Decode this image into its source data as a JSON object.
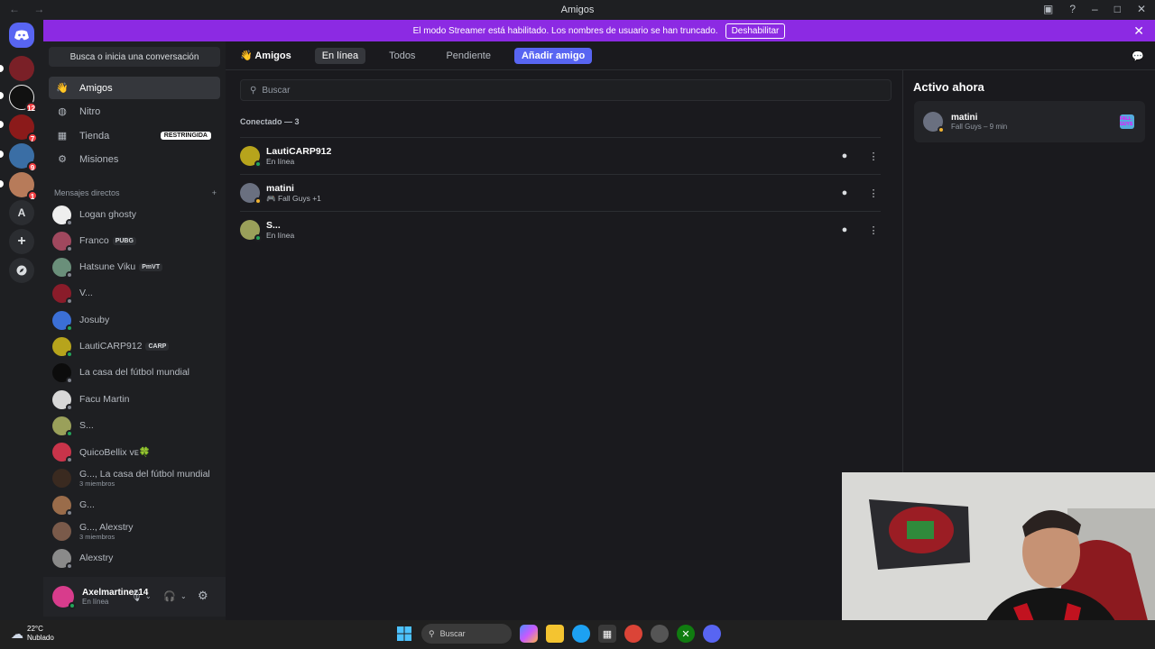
{
  "window": {
    "title": "Amigos",
    "nav_arrows": "← →"
  },
  "banner": {
    "text": "El modo Streamer está habilitado. Los nombres de usuario se han truncado.",
    "button": "Deshabilitar"
  },
  "servers": [
    {
      "label": "",
      "badge": ""
    },
    {
      "label": "",
      "badge": "12"
    },
    {
      "label": "",
      "badge": "7"
    },
    {
      "label": "",
      "badge": "9"
    },
    {
      "label": "",
      "badge": "1"
    },
    {
      "label": "A",
      "badge": ""
    }
  ],
  "sidebar": {
    "search": "Busca o inicia una conversación",
    "menu": [
      {
        "label": "Amigos"
      },
      {
        "label": "Nitro"
      },
      {
        "label": "Tienda",
        "tag": "RESTRINGIDA"
      },
      {
        "label": "Misiones"
      }
    ],
    "dm_header": "Mensajes directos",
    "dms": [
      {
        "name": "Logan ghosty",
        "tag": "",
        "sub": ""
      },
      {
        "name": "Franco",
        "tag": "PUBG",
        "sub": ""
      },
      {
        "name": "Hatsune Viku",
        "tag": "PmVT",
        "sub": ""
      },
      {
        "name": "V...",
        "tag": "",
        "sub": ""
      },
      {
        "name": "Josuby",
        "tag": "",
        "sub": ""
      },
      {
        "name": "LautiCARP912",
        "tag": "CARP",
        "sub": ""
      },
      {
        "name": "La casa del fútbol mundial",
        "tag": "",
        "sub": ""
      },
      {
        "name": "Facu Martin",
        "tag": "",
        "sub": ""
      },
      {
        "name": "S...",
        "tag": "",
        "sub": ""
      },
      {
        "name": "QuicoBellix ᴠᴇ🍀",
        "tag": "",
        "sub": ""
      },
      {
        "name": "G..., La casa del fútbol mundial",
        "tag": "",
        "sub": "3 miembros"
      },
      {
        "name": "G...",
        "tag": "",
        "sub": ""
      },
      {
        "name": "G..., Alexstry",
        "tag": "",
        "sub": "3 miembros"
      },
      {
        "name": "Alexstry",
        "tag": "",
        "sub": ""
      }
    ],
    "user": {
      "name": "Axelmartinez14",
      "status": "En línea"
    }
  },
  "topnav": {
    "title": "Amigos",
    "tabs": [
      "En línea",
      "Todos",
      "Pendiente"
    ],
    "add_friend": "Añadir amigo"
  },
  "friends": {
    "search_placeholder": "Buscar",
    "section": "Conectado — 3",
    "list": [
      {
        "name": "LautiCARP912",
        "status": "En línea"
      },
      {
        "name": "matini",
        "status": "Fall Guys +1"
      },
      {
        "name": "S...",
        "status": "En línea"
      }
    ]
  },
  "active_now": {
    "title": "Activo ahora",
    "name": "matini",
    "activity": "Fall Guys – 9 min",
    "game_badge": "FALL GUYS"
  },
  "taskbar": {
    "temp": "22°C",
    "weather": "Nublado",
    "search": "Buscar"
  },
  "colors": {
    "accent": "#5865f2",
    "banner": "#8c2ae3",
    "online": "#23a55a",
    "badge": "#f23f43"
  }
}
